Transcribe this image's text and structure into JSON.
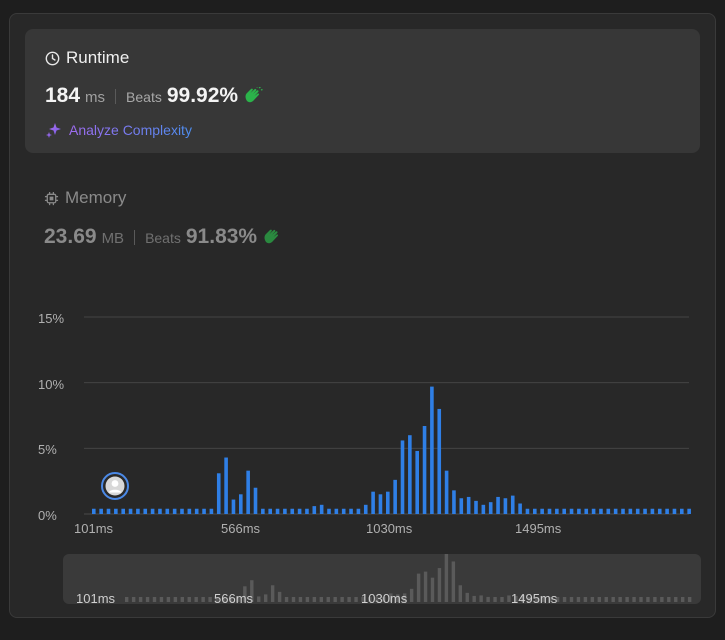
{
  "runtime": {
    "title": "Runtime",
    "value": "184",
    "unit": "ms",
    "beats_label": "Beats",
    "beats_value": "99.92%",
    "analyze_label": "Analyze Complexity"
  },
  "memory": {
    "title": "Memory",
    "value": "23.69",
    "unit": "MB",
    "beats_label": "Beats",
    "beats_value": "91.83%"
  },
  "colors": {
    "bar": "#2f7fe6",
    "clap": "#2bb34a",
    "accent_start": "#9f6bf0",
    "accent_end": "#4d8ef0"
  },
  "icons": [
    "clock-icon",
    "cpu-icon",
    "clap-icon",
    "sparkle-icon",
    "avatar-icon"
  ],
  "chart_data": {
    "type": "bar",
    "y_ticks": [
      "15%",
      "10%",
      "5%",
      "0%"
    ],
    "ylim": [
      0,
      15
    ],
    "x_ticks": [
      "101ms",
      "566ms",
      "1030ms",
      "1495ms"
    ],
    "grid": true,
    "marker_value": "184ms",
    "values": [
      0.4,
      0.4,
      0.4,
      0.4,
      0.4,
      0.4,
      0.4,
      0.4,
      0.4,
      0.4,
      0.4,
      0.4,
      0.4,
      0.4,
      0.4,
      0.4,
      0.4,
      3.1,
      4.3,
      1.1,
      1.5,
      3.3,
      2.0,
      0.4,
      0.4,
      0.4,
      0.4,
      0.4,
      0.4,
      0.4,
      0.6,
      0.7,
      0.4,
      0.4,
      0.4,
      0.4,
      0.4,
      0.7,
      1.7,
      1.5,
      1.7,
      2.6,
      5.6,
      6.0,
      4.8,
      6.7,
      9.7,
      8.0,
      3.3,
      1.8,
      1.2,
      1.3,
      1.0,
      0.7,
      0.9,
      1.3,
      1.2,
      1.4,
      0.8,
      0.4,
      0.4,
      0.4,
      0.4,
      0.4,
      0.4,
      0.4,
      0.4,
      0.4,
      0.4,
      0.4,
      0.4,
      0.4,
      0.4,
      0.4,
      0.4,
      0.4,
      0.4,
      0.4,
      0.4,
      0.4,
      0.4,
      0.4
    ]
  },
  "overview": {
    "x_ticks": [
      "101ms",
      "566ms",
      "1030ms",
      "1495ms"
    ]
  }
}
